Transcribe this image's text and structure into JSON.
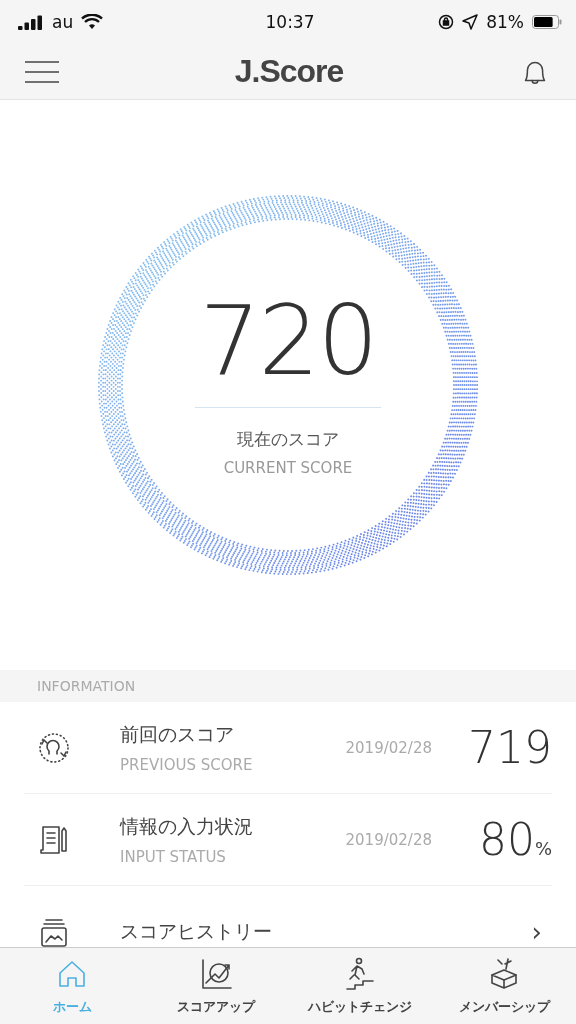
{
  "status_bar": {
    "carrier": "au",
    "time": "10:37",
    "battery": "81%",
    "level": 0.81
  },
  "header": {
    "title": "J.Score"
  },
  "score": {
    "value": "720",
    "label": "現在のスコア",
    "sublabel": "CURRENT SCORE"
  },
  "information": {
    "heading": "INFORMATION",
    "rows": [
      {
        "kind": "value",
        "title": "前回のスコア",
        "subtitle": "PREVIOUS SCORE",
        "date": "2019/02/28",
        "value": "719"
      },
      {
        "kind": "value",
        "title": "情報の入力状況",
        "subtitle": "INPUT STATUS",
        "date": "2019/02/28",
        "value": "80",
        "unit": "%"
      },
      {
        "kind": "link",
        "title": "スコアヒストリー",
        "chevron": "›"
      }
    ]
  },
  "tabs": [
    {
      "label": "ホーム",
      "selected": true
    },
    {
      "label": "スコアアップ",
      "selected": false
    },
    {
      "label": "ハビットチェンジ",
      "selected": false
    },
    {
      "label": "メンバーシップ",
      "selected": false
    }
  ]
}
